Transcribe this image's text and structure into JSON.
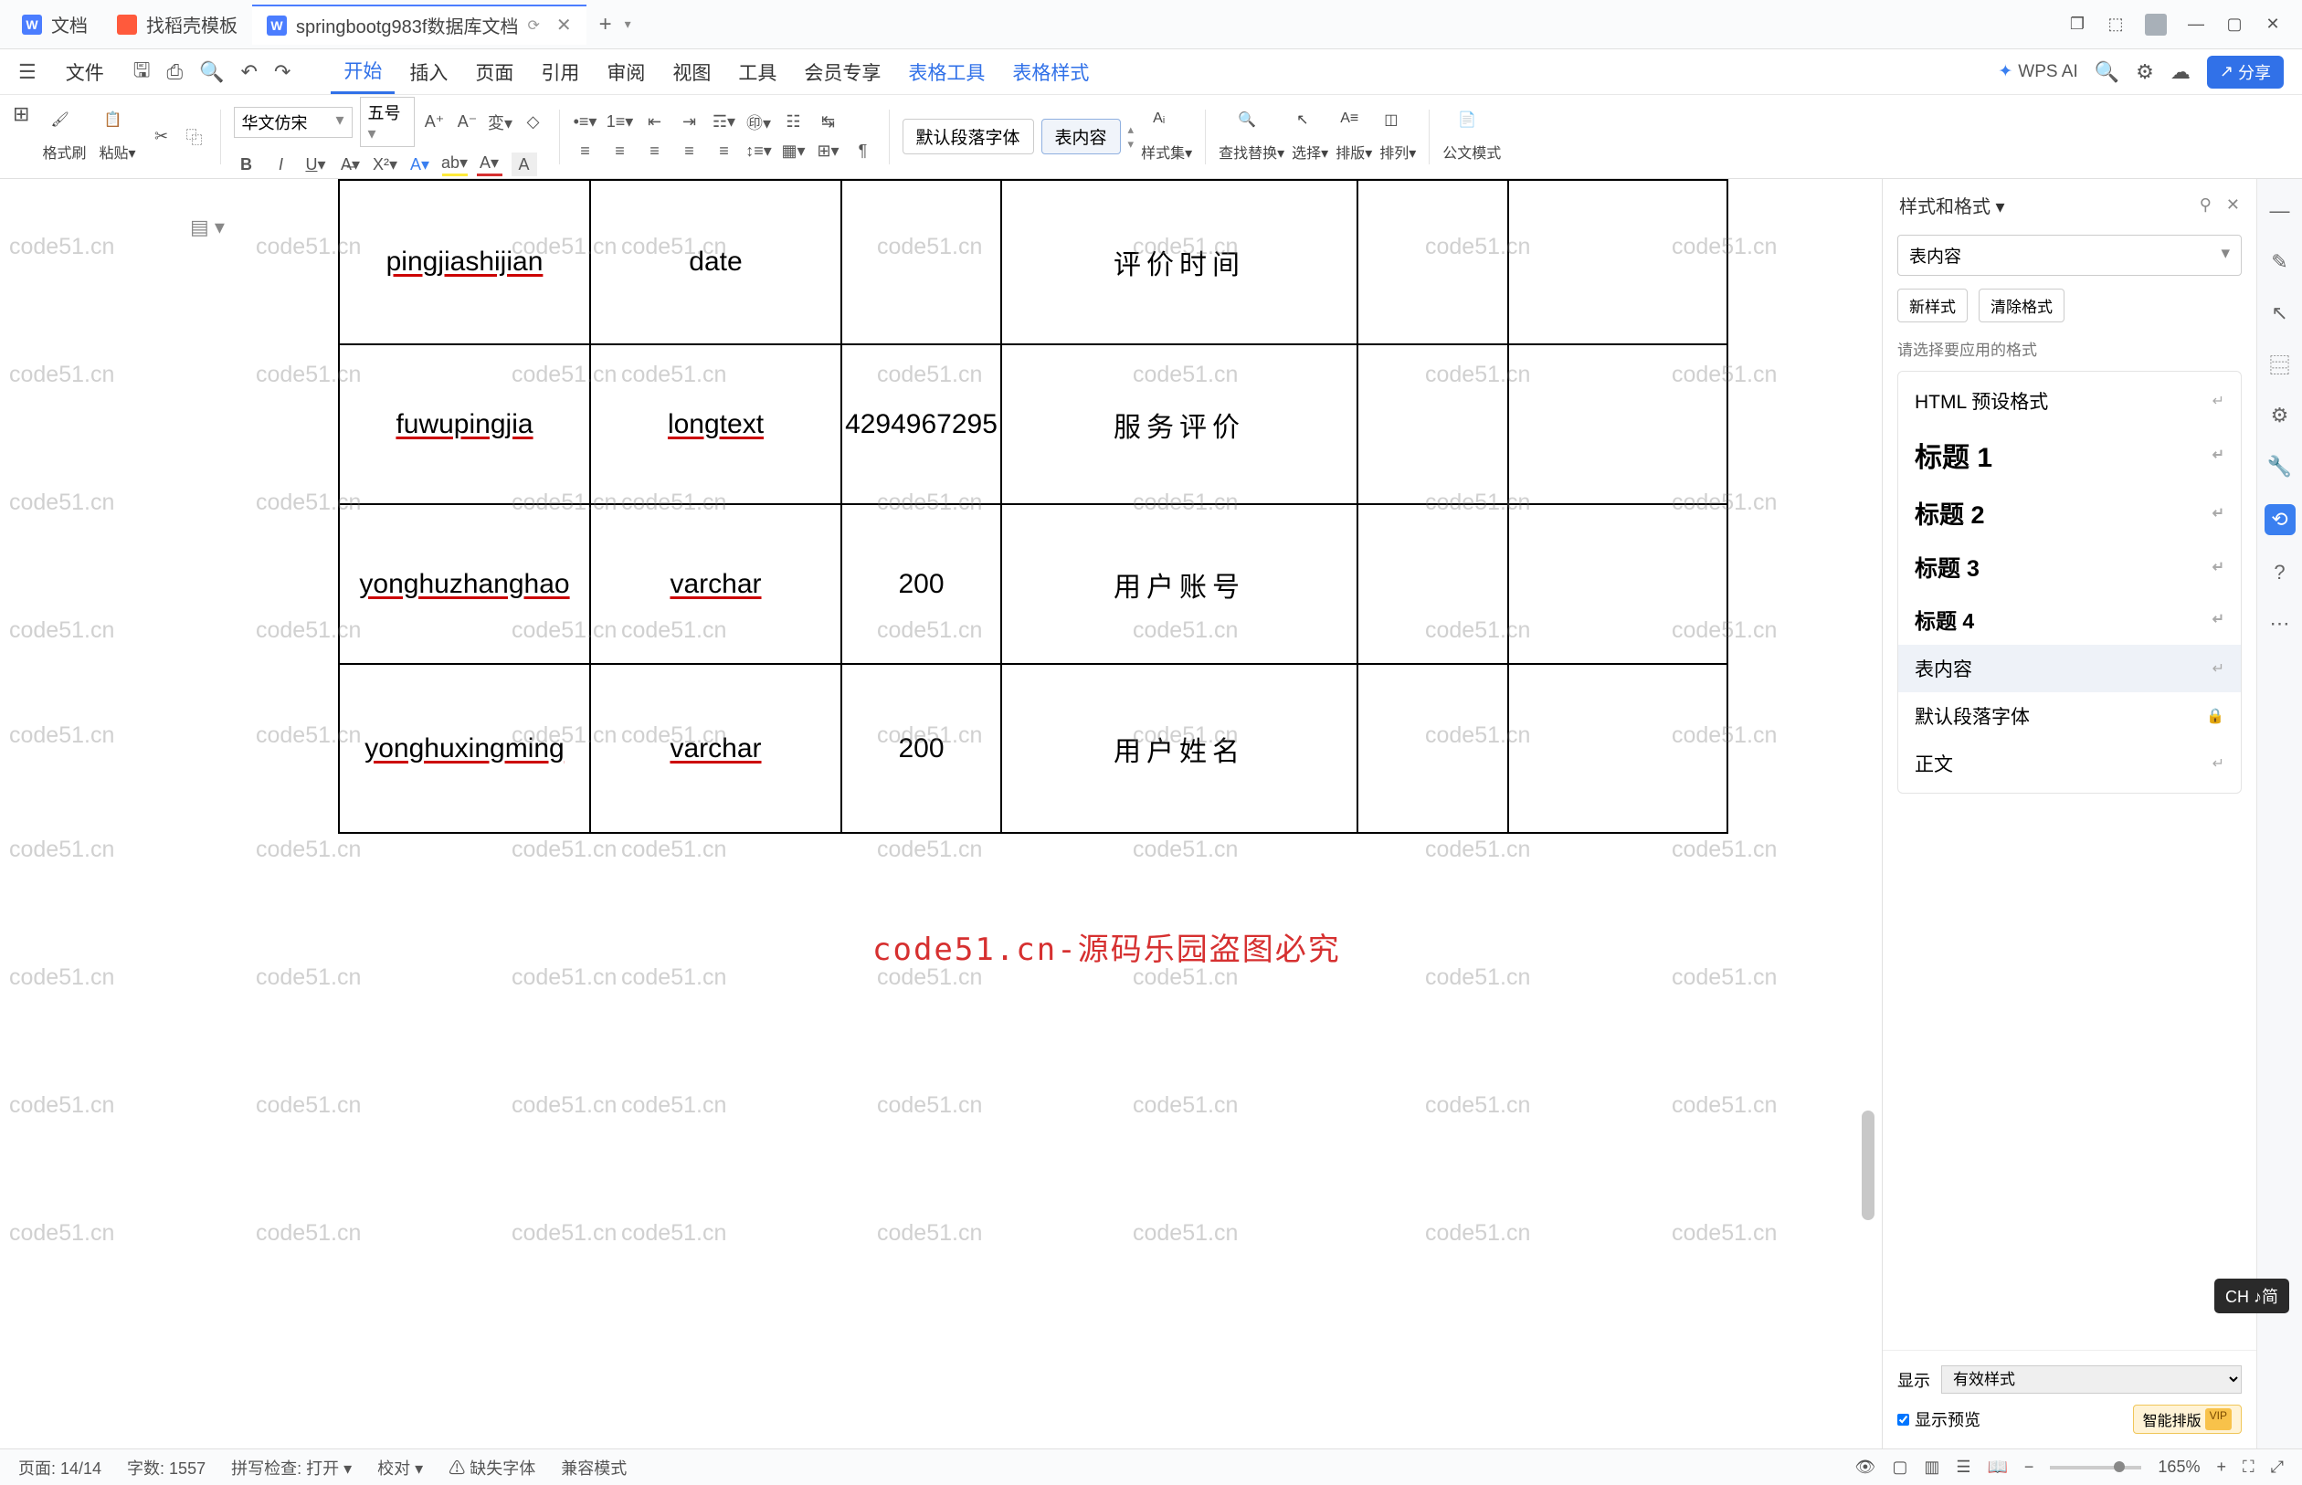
{
  "tabs": [
    {
      "icon": "doc",
      "label": "文档"
    },
    {
      "icon": "dao",
      "label": "找稻壳模板"
    },
    {
      "icon": "doc",
      "label": "springbootg983f数据库文档",
      "active": true
    }
  ],
  "menu": {
    "file": "文件",
    "items": [
      "开始",
      "插入",
      "页面",
      "引用",
      "审阅",
      "视图",
      "工具",
      "会员专享",
      "表格工具",
      "表格样式"
    ],
    "active": "开始",
    "blue_items": [
      "表格工具",
      "表格样式"
    ],
    "wps_ai": "WPS AI",
    "share": "分享"
  },
  "ribbon": {
    "format_brush": "格式刷",
    "paste": "粘贴",
    "font_name": "华文仿宋",
    "font_size": "五号",
    "default_para": "默认段落字体",
    "table_content": "表内容",
    "style_set": "样式集",
    "find_replace": "查找替换",
    "select": "选择",
    "sort": "排版",
    "arrange": "排列",
    "formula_mode": "公文模式"
  },
  "table": {
    "rows": [
      {
        "c1": "pingjiashijian",
        "c2": "date",
        "c3": "",
        "c4": "评价时间",
        "c5": "",
        "c6": ""
      },
      {
        "c1": "fuwupingjia",
        "c2": "longtext",
        "c3": "4294967295",
        "c4": "服务评价",
        "c5": "",
        "c6": ""
      },
      {
        "c1": "yonghuzhanghao",
        "c2": "varchar",
        "c3": "200",
        "c4": "用户账号",
        "c5": "",
        "c6": ""
      },
      {
        "c1": "yonghuxingming",
        "c2": "varchar",
        "c3": "200",
        "c4": "用户姓名",
        "c5": "",
        "c6": ""
      }
    ]
  },
  "watermark_red": "code51.cn-源码乐园盗图必究",
  "watermark_text": "code51.cn",
  "right_panel": {
    "title": "样式和格式",
    "current_style": "表内容",
    "new_style": "新样式",
    "clear_format": "清除格式",
    "hint": "请选择要应用的格式",
    "styles": [
      {
        "label": "HTML 预设格式",
        "class": ""
      },
      {
        "label": "标题 1",
        "class": "h1"
      },
      {
        "label": "标题 2",
        "class": "h2"
      },
      {
        "label": "标题 3",
        "class": "h3"
      },
      {
        "label": "标题 4",
        "class": "h4"
      },
      {
        "label": "表内容",
        "class": "sel"
      },
      {
        "label": "默认段落字体",
        "class": ""
      },
      {
        "label": "正文",
        "class": ""
      }
    ],
    "show_label": "显示",
    "show_value": "有效样式",
    "show_preview": "显示预览",
    "smart_layout": "智能排版"
  },
  "statusbar": {
    "page": "页面: 14/14",
    "words": "字数: 1557",
    "spell": "拼写检查: 打开",
    "proofread": "校对",
    "missing_fonts": "缺失字体",
    "compat": "兼容模式",
    "zoom": "165%"
  },
  "ime": "CH ♪简"
}
